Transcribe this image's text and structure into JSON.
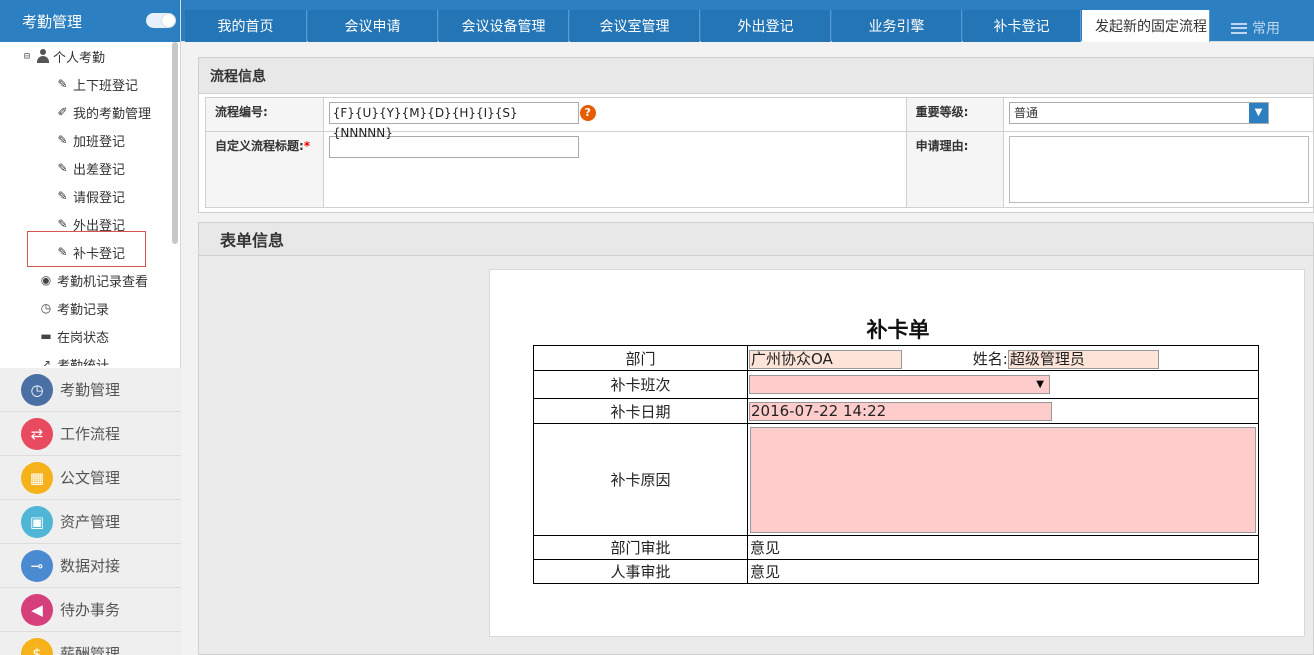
{
  "sidebar": {
    "title": "考勤管理",
    "tree": {
      "root": {
        "expander": "⊟",
        "label": "个人考勤"
      },
      "children": [
        {
          "icon": "edit-icon",
          "glyph": "✎",
          "label": "上下班登记"
        },
        {
          "icon": "pencil-icon",
          "glyph": "✐",
          "label": "我的考勤管理"
        },
        {
          "icon": "edit-icon",
          "glyph": "✎",
          "label": "加班登记"
        },
        {
          "icon": "edit-icon",
          "glyph": "✎",
          "label": "出差登记"
        },
        {
          "icon": "edit-icon",
          "glyph": "✎",
          "label": "请假登记"
        },
        {
          "icon": "edit-icon",
          "glyph": "✎",
          "label": "外出登记"
        },
        {
          "icon": "edit-icon",
          "glyph": "✎",
          "label": "补卡登记"
        }
      ],
      "siblings": [
        {
          "icon": "eye-icon",
          "glyph": "◉",
          "label": "考勤机记录查看"
        },
        {
          "icon": "clock-icon",
          "glyph": "◷",
          "label": "考勤记录"
        },
        {
          "icon": "card-icon",
          "glyph": "▬",
          "label": "在岗状态"
        },
        {
          "icon": "stats-icon",
          "glyph": "↗",
          "label": "考勤统计"
        }
      ]
    },
    "modules": [
      {
        "label": "考勤管理",
        "icon": "clock-icon",
        "glyph": "◷",
        "color": "#4a6fa5"
      },
      {
        "label": "工作流程",
        "icon": "flow-icon",
        "glyph": "⇄",
        "color": "#e84a5f"
      },
      {
        "label": "公文管理",
        "icon": "doc-icon",
        "glyph": "▦",
        "color": "#f5b21a"
      },
      {
        "label": "资产管理",
        "icon": "asset-icon",
        "glyph": "▣",
        "color": "#4fb6d6"
      },
      {
        "label": "数据对接",
        "icon": "plug-icon",
        "glyph": "⊸",
        "color": "#4a8ad0"
      },
      {
        "label": "待办事务",
        "icon": "speaker-icon",
        "glyph": "◀",
        "color": "#d6407a"
      },
      {
        "label": "薪酬管理",
        "icon": "money-icon",
        "glyph": "$",
        "color": "#f5b21a"
      }
    ]
  },
  "tabs": [
    {
      "label": "我的首页",
      "active": false
    },
    {
      "label": "会议申请",
      "active": false
    },
    {
      "label": "会议设备管理",
      "active": false
    },
    {
      "label": "会议室管理",
      "active": false
    },
    {
      "label": "外出登记",
      "active": false
    },
    {
      "label": "业务引擎",
      "active": false
    },
    {
      "label": "补卡登记",
      "active": false
    },
    {
      "label": "发起新的固定流程",
      "active": true
    }
  ],
  "tab_more": {
    "label": "常用"
  },
  "flow_info": {
    "title": "流程信息",
    "number_label": "流程编号:",
    "number_value": "{F}{U}{Y}{M}{D}{H}{I}{S}{NNNNN}",
    "help_glyph": "?",
    "priority_label": "重要等级:",
    "priority_value": "普通",
    "custom_title_label": "自定义流程标题:",
    "required_mark": "*",
    "custom_title_value": "",
    "reason_label": "申请理由:",
    "reason_value": ""
  },
  "form_info": {
    "title": "表单信息",
    "form_title": "补卡单",
    "rows": {
      "dept_label": "部门",
      "dept_value": "广州协众OA",
      "name_label": "姓名:",
      "name_value": "超级管理员",
      "shift_label": "补卡班次",
      "shift_value": "",
      "date_label": "补卡日期",
      "date_value": "2016-07-22 14:22",
      "reason_label": "补卡原因",
      "reason_value": "",
      "dept_approval_label": "部门审批",
      "dept_approval_value": "意见",
      "hr_approval_label": "人事审批",
      "hr_approval_value": "意见"
    }
  }
}
